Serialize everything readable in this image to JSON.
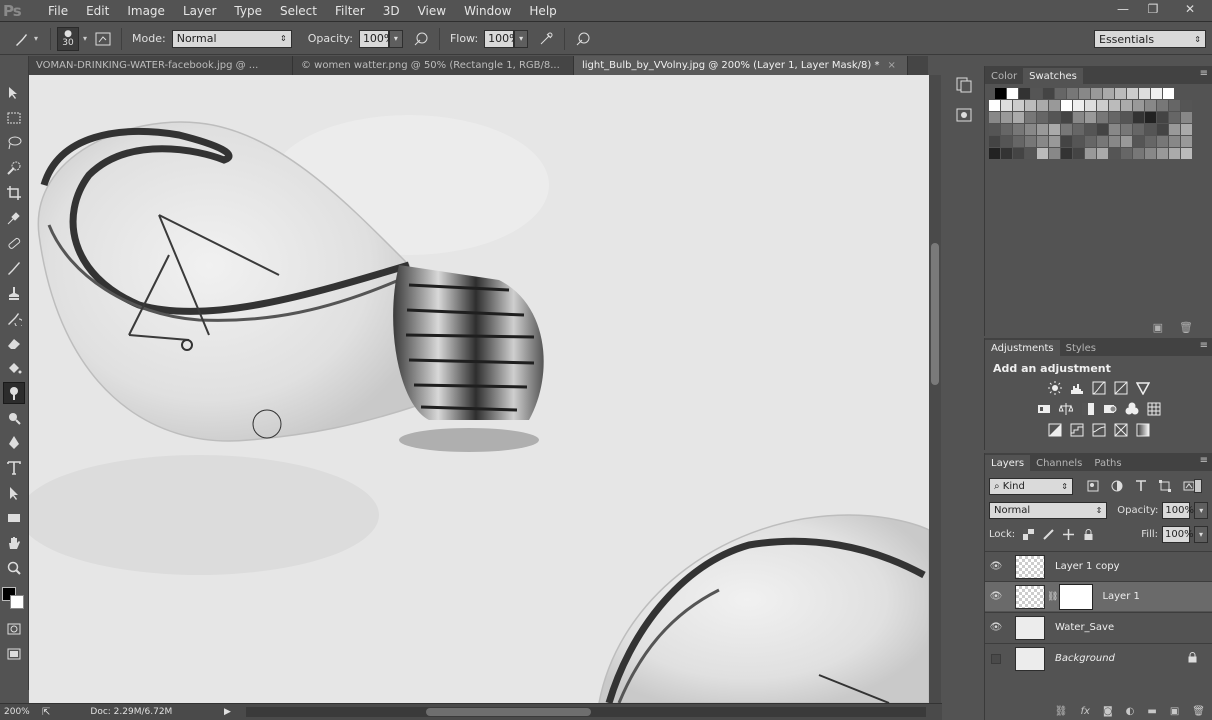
{
  "app": {
    "logo": "Ps"
  },
  "menu": [
    "File",
    "Edit",
    "Image",
    "Layer",
    "Type",
    "Select",
    "Filter",
    "3D",
    "View",
    "Window",
    "Help"
  ],
  "window_controls": {
    "minimize": "—",
    "restore": "❐",
    "close": "✕"
  },
  "options": {
    "brush_size": "30",
    "mode_label": "Mode:",
    "mode_value": "Normal",
    "opacity_label": "Opacity:",
    "opacity_value": "100%",
    "flow_label": "Flow:",
    "flow_value": "100%",
    "workspace": "Essentials"
  },
  "tabs": [
    {
      "label": "VOMAN-DRINKING-WATER-facebook.jpg @ ...",
      "active": false
    },
    {
      "label": "© women watter.png @ 50% (Rectangle 1, RGB/8...",
      "active": false
    },
    {
      "label": "light_Bulb_by_VVolny.jpg @ 200% (Layer 1, Layer Mask/8) *",
      "active": true
    }
  ],
  "tab_close": "×",
  "status": {
    "zoom": "200%",
    "doc": "Doc: 2.29M/6.72M"
  },
  "swatches_panel": {
    "tabs": [
      "Color",
      "Swatches"
    ],
    "active": "Swatches"
  },
  "adjustments_panel": {
    "tabs": [
      "Adjustments",
      "Styles"
    ],
    "title": "Add an adjustment"
  },
  "layers_panel": {
    "tabs": [
      "Layers",
      "Channels",
      "Paths"
    ],
    "kind": "Kind",
    "blend_mode": "Normal",
    "opacity_label": "Opacity:",
    "opacity_value": "100%",
    "lock_label": "Lock:",
    "fill_label": "Fill:",
    "fill_value": "100%",
    "layers": [
      {
        "name": "Layer 1 copy",
        "visible": true
      },
      {
        "name": "Layer 1",
        "visible": true,
        "selected": true
      },
      {
        "name": "Water_Save",
        "visible": true
      },
      {
        "name": "Background",
        "visible": false
      }
    ]
  },
  "colors": {
    "ui_bg": "#535353",
    "panel_dark": "#424242",
    "canvas_bg": "#e8e8e8",
    "selected_layer": "#6a6a6a"
  }
}
